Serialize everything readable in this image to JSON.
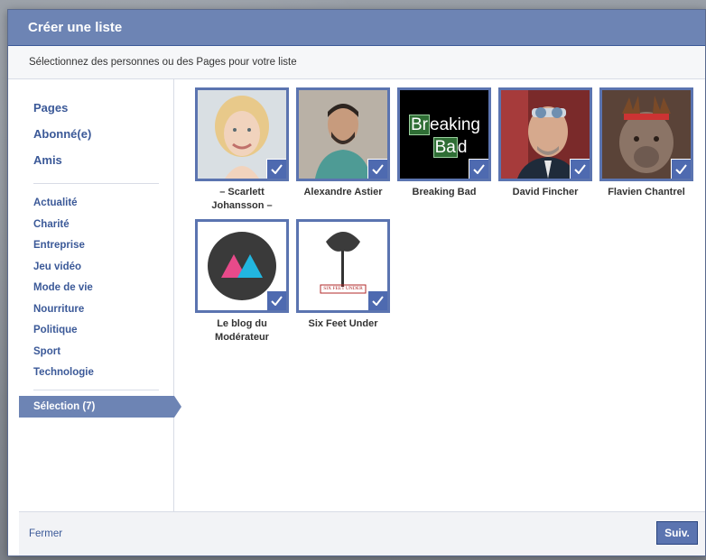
{
  "dialog": {
    "title": "Créer une liste",
    "subtitle": "Sélectionnez des personnes ou des Pages pour votre liste"
  },
  "sidebar": {
    "top_items": [
      {
        "label": "Pages"
      },
      {
        "label": "Abonné(e)"
      },
      {
        "label": "Amis"
      }
    ],
    "categories": [
      {
        "label": "Actualité"
      },
      {
        "label": "Charité"
      },
      {
        "label": "Entreprise"
      },
      {
        "label": "Jeu vidéo"
      },
      {
        "label": "Mode de vie"
      },
      {
        "label": "Nourriture"
      },
      {
        "label": "Politique"
      },
      {
        "label": "Sport"
      },
      {
        "label": "Technologie"
      }
    ],
    "selection_label": "Sélection (7)"
  },
  "tiles": [
    {
      "name": "– Scarlett Johansson –",
      "image": "portrait-blonde-woman",
      "selected": true
    },
    {
      "name": "Alexandre Astier",
      "image": "portrait-bearded-man",
      "selected": true
    },
    {
      "name": "Breaking Bad",
      "image": "breaking-bad-logo",
      "logo_line1_symbol": "Br",
      "logo_line1_rest": "eaking",
      "logo_line2_symbol": "Ba",
      "logo_line2_rest": "d",
      "selected": true
    },
    {
      "name": "David Fincher",
      "image": "portrait-man-sunglasses",
      "selected": true
    },
    {
      "name": "Flavien Chantrel",
      "image": "dog-with-antlers",
      "selected": true
    },
    {
      "name": "Le blog du Modérateur",
      "image": "triangles-logo",
      "selected": true
    },
    {
      "name": "Six Feet Under",
      "image": "tree-logo",
      "logo_text": "SIX FEET UNDER",
      "selected": true
    }
  ],
  "footer": {
    "close_label": "Fermer",
    "next_label": "Suiv."
  },
  "colors": {
    "header": "#6d84b4",
    "accent": "#3b5998",
    "tile_border": "#5b74b0",
    "check_bg": "#4e6ab0"
  }
}
